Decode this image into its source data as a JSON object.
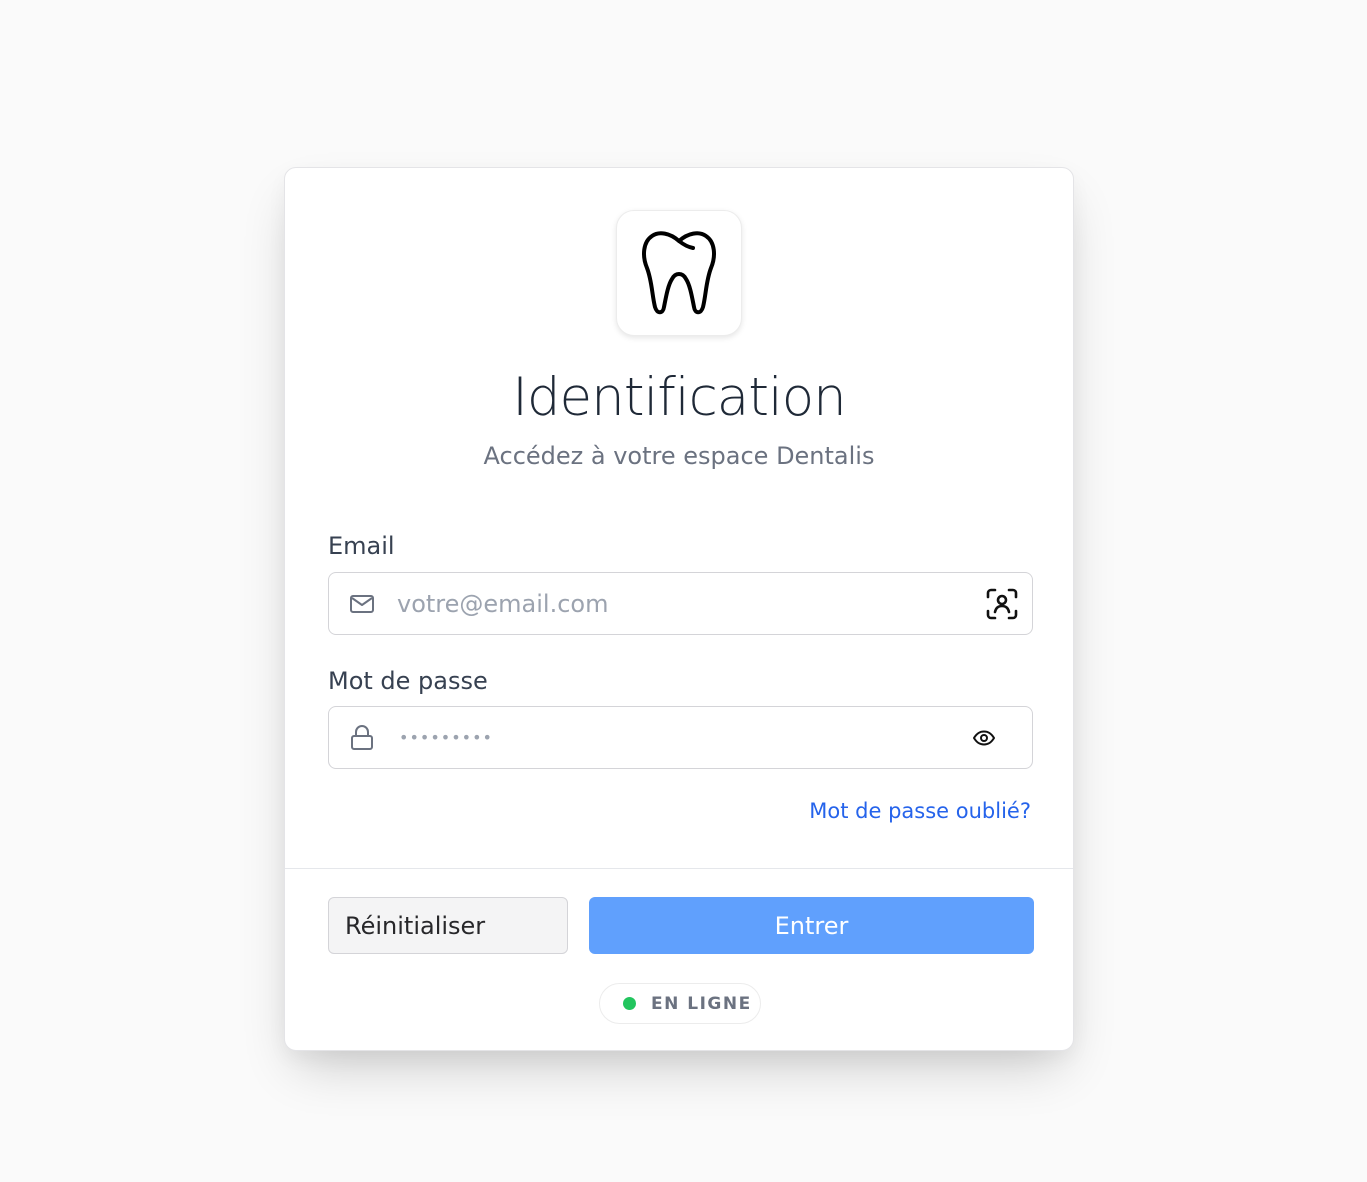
{
  "header": {
    "title": "Identification",
    "subtitle": "Accédez à votre espace Dentalis",
    "logo_icon": "tooth-icon"
  },
  "form": {
    "email": {
      "label": "Email",
      "placeholder": "votre@email.com",
      "value": "",
      "lead_icon": "mail-icon",
      "trail_icon": "face-id-icon"
    },
    "password": {
      "label": "Mot de passe",
      "masked_value": "•••••••••",
      "lead_icon": "lock-icon",
      "trail_icon": "eye-icon"
    },
    "forgot_link": "Mot de passe oublié?"
  },
  "actions": {
    "reset_label": "Réinitialiser",
    "submit_label": "Entrer"
  },
  "status": {
    "label": "EN LIGNE",
    "color": "#22c55e"
  },
  "colors": {
    "accent": "#60a0fd",
    "link": "#2563eb"
  }
}
